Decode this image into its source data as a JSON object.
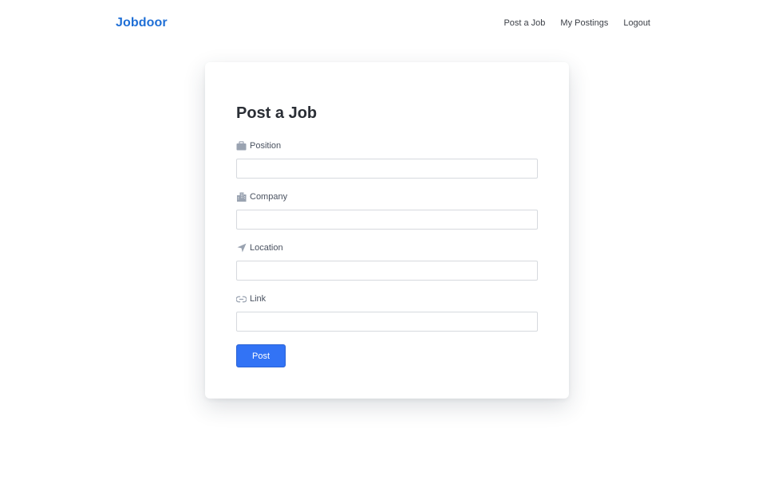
{
  "navbar": {
    "brand": "Jobdoor",
    "links": [
      "Post a Job",
      "My Postings",
      "Logout"
    ]
  },
  "form": {
    "title": "Post a Job",
    "fields": [
      {
        "label": "Position",
        "icon": "briefcase-icon",
        "value": ""
      },
      {
        "label": "Company",
        "icon": "building-icon",
        "value": ""
      },
      {
        "label": "Location",
        "icon": "location-arrow-icon",
        "value": ""
      },
      {
        "label": "Link",
        "icon": "link-icon",
        "value": ""
      }
    ],
    "submit_label": "Post"
  },
  "colors": {
    "brand": "#1f6fd6",
    "button": "#3273f5",
    "icon": "#9aa3b1"
  }
}
